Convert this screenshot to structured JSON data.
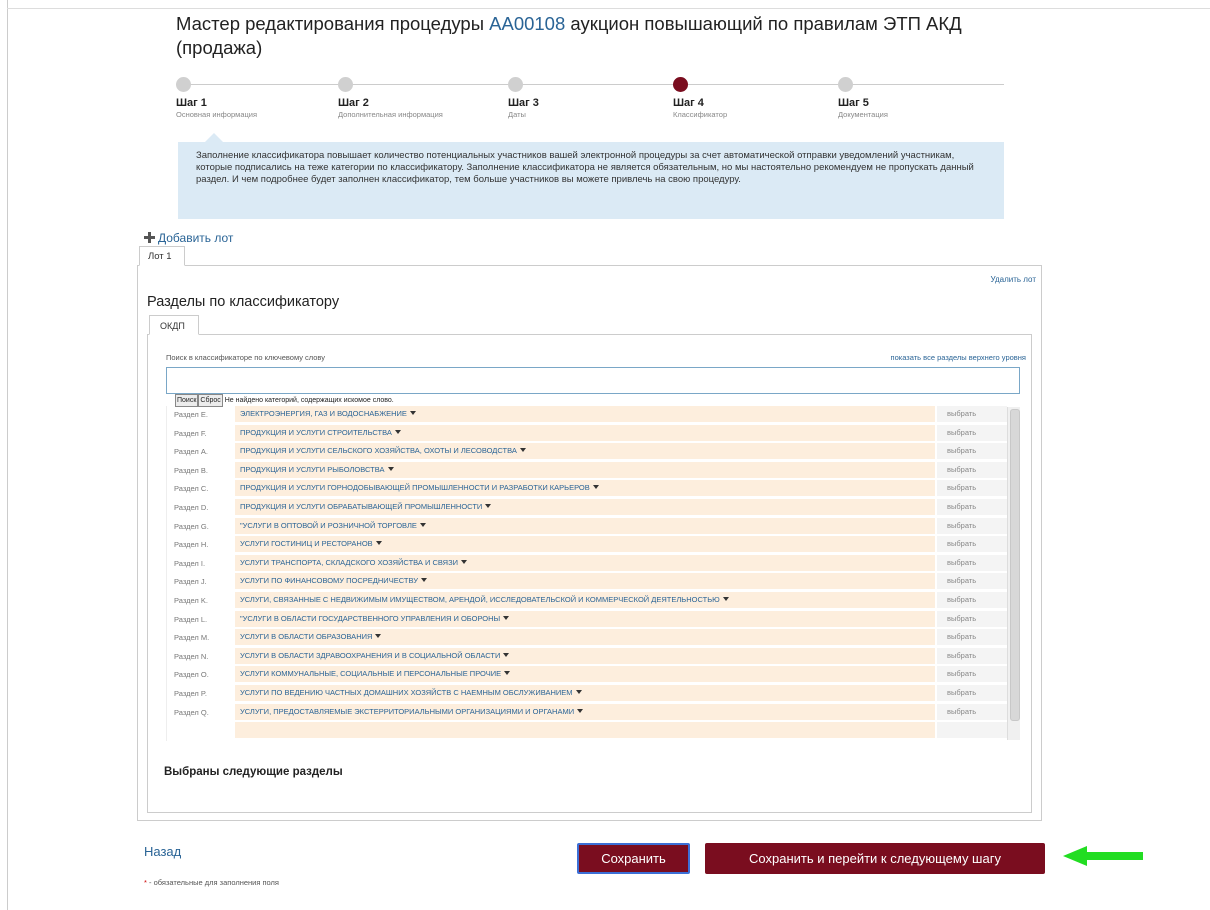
{
  "header": {
    "title_prefix": "Мастер редактирования процедуры",
    "procedure_code": "АА00108",
    "title_suffix": "аукцион повышающий по правилам ЭТП АКД (продажа)"
  },
  "steps": [
    {
      "name": "Шаг 1",
      "desc": "Основная информация"
    },
    {
      "name": "Шаг 2",
      "desc": "Дополнительная информация"
    },
    {
      "name": "Шаг 3",
      "desc": "Даты"
    },
    {
      "name": "Шаг 4",
      "desc": "Классификатор"
    },
    {
      "name": "Шаг 5",
      "desc": "Документация"
    }
  ],
  "active_step": 4,
  "info_text": "Заполнение классификатора повышает количество потенциальных участников вашей электронной процедуры за счет автоматической отправки уведомлений участникам, которые подписались на теже категории по классификатору. Заполнение классификатора не является обязательным, но мы настоятельно рекомендуем не пропускать данный раздел. И чем подробнее будет заполнен классификатор, тем больше участников вы можете привлечь на свою процедуру.",
  "add_lot_label": "Добавить лот",
  "lot_tab_label": "Лот 1",
  "delete_lot_label": "Удалить лот",
  "sections_title": "Разделы по классификатору",
  "okdp_tab_label": "ОКДП",
  "search": {
    "label": "Поиск в классификаторе по ключевому слову",
    "show_all": "показать все разделы верхнего уровня",
    "value": "",
    "search_button": "Поиск",
    "reset_button": "Сброс",
    "not_found": "Не найдено категорий, содержащих искомое слово."
  },
  "pick_label": "выбрать",
  "rows": [
    {
      "section": "Раздел E.",
      "name": "Электроэнергия, газ и водоснабжение"
    },
    {
      "section": "Раздел F.",
      "name": "Продукция и услуги строительства"
    },
    {
      "section": "Раздел A.",
      "name": "Продукция и услуги сельского хозяйства, охоты и лесоводства"
    },
    {
      "section": "Раздел B.",
      "name": "Продукция и услуги рыболовства"
    },
    {
      "section": "Раздел C.",
      "name": "Продукция и услуги горнодобывающей промышленности и разработки карьеров"
    },
    {
      "section": "Раздел D.",
      "name": "Продукция и услуги обрабатывающей промышленности"
    },
    {
      "section": "Раздел G.",
      "name": "\"Услуги в оптовой и розничной торговле"
    },
    {
      "section": "Раздел H.",
      "name": "Услуги гостиниц и ресторанов"
    },
    {
      "section": "Раздел I.",
      "name": "Услуги транспорта, складского хозяйства и связи"
    },
    {
      "section": "Раздел J.",
      "name": "Услуги по финансовому посредничеству"
    },
    {
      "section": "Раздел K.",
      "name": "Услуги, связанные с недвижимым имуществом, арендой, исследовательской и коммерческой деятельностью"
    },
    {
      "section": "Раздел L.",
      "name": "\"Услуги в области государственного управления и обороны"
    },
    {
      "section": "Раздел M.",
      "name": "Услуги в области образования"
    },
    {
      "section": "Раздел N.",
      "name": "Услуги в области здравоохранения и в социальной области"
    },
    {
      "section": "Раздел O.",
      "name": "Услуги коммунальные, социальные и персональные прочие"
    },
    {
      "section": "Раздел P.",
      "name": "Услуги по ведению частных домашних хозяйств с наемным обслуживанием"
    },
    {
      "section": "Раздел Q.",
      "name": "Услуги, предоставляемые экстерриториальными организациями и органами"
    }
  ],
  "selected_title": "Выбраны следующие разделы",
  "back_label": "Назад",
  "required_note": "- обязательные для заполнения поля",
  "required_star": "*",
  "save_label": "Сохранить",
  "save_next_label": "Сохранить и перейти к следующему шагу",
  "colors": {
    "accent": "#7a0d1f",
    "link": "#2a6496",
    "info_bg": "#dbeaf5",
    "row_bg": "#fdeedd",
    "arrow": "#22dd22"
  }
}
